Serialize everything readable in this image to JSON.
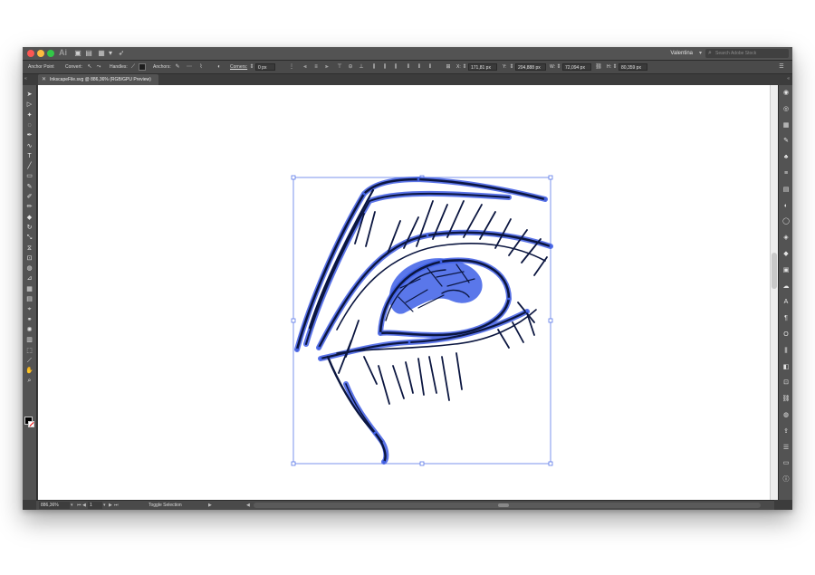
{
  "app": {
    "logo": "Ai",
    "workspace": "Valentina"
  },
  "search": {
    "placeholder": "Search Adobe Stock"
  },
  "control_bar": {
    "anchor_point": "Anchor Point",
    "convert": "Convert:",
    "handles": "Handles:",
    "anchors": "Anchors:",
    "corners": "Corners:",
    "corners_value": "0 px",
    "x_label": "X:",
    "x_value": "171,81 px",
    "y_label": "Y:",
    "y_value": "204,888 px",
    "w_label": "W:",
    "w_value": "72,094 px",
    "h_label": "H:",
    "h_value": "80,359 px"
  },
  "document": {
    "tab_title": "InkscapeFile.svg @ 886,36% (RGB/GPU Preview)"
  },
  "status_bar": {
    "zoom": "886,36%",
    "artboard": "1",
    "status_text": "Toggle Selection"
  },
  "colors": {
    "ui_dark": "#535353",
    "stroke": "#0b1640",
    "selection": "#3f5be0",
    "fill": "#000000",
    "stroke_swatch": "#ffffff"
  },
  "icons": {
    "tools": [
      "selection-tool-icon",
      "direct-selection-tool-icon",
      "magic-wand-tool-icon",
      "lasso-tool-icon",
      "pen-tool-icon",
      "curvature-tool-icon",
      "type-tool-icon",
      "line-segment-tool-icon",
      "rectangle-tool-icon",
      "paintbrush-tool-icon",
      "shaper-tool-icon",
      "pencil-tool-icon",
      "eraser-tool-icon",
      "rotate-tool-icon",
      "scale-tool-icon",
      "width-tool-icon",
      "free-transform-tool-icon",
      "shape-builder-tool-icon",
      "perspective-grid-tool-icon",
      "mesh-tool-icon",
      "gradient-tool-icon",
      "eyedropper-tool-icon",
      "blend-tool-icon",
      "symbol-sprayer-tool-icon",
      "column-graph-tool-icon",
      "artboard-tool-icon",
      "slice-tool-icon",
      "hand-tool-icon",
      "zoom-tool-icon"
    ],
    "dock": [
      "color-panel-icon",
      "color-guide-icon",
      "swatches-icon",
      "brushes-icon",
      "symbols-icon",
      "stroke-icon",
      "gradient-icon",
      "transparency-icon",
      "appearance-icon",
      "graphic-styles-icon",
      "layers-icon",
      "artboards-icon",
      "libraries-icon",
      "character-icon",
      "paragraph-icon",
      "opentype-icon",
      "align-icon",
      "pathfinder-icon",
      "transform-icon",
      "links-icon",
      "image-trace-icon",
      "asset-export-icon",
      "properties-icon",
      "navigator-icon",
      "info-icon"
    ]
  }
}
